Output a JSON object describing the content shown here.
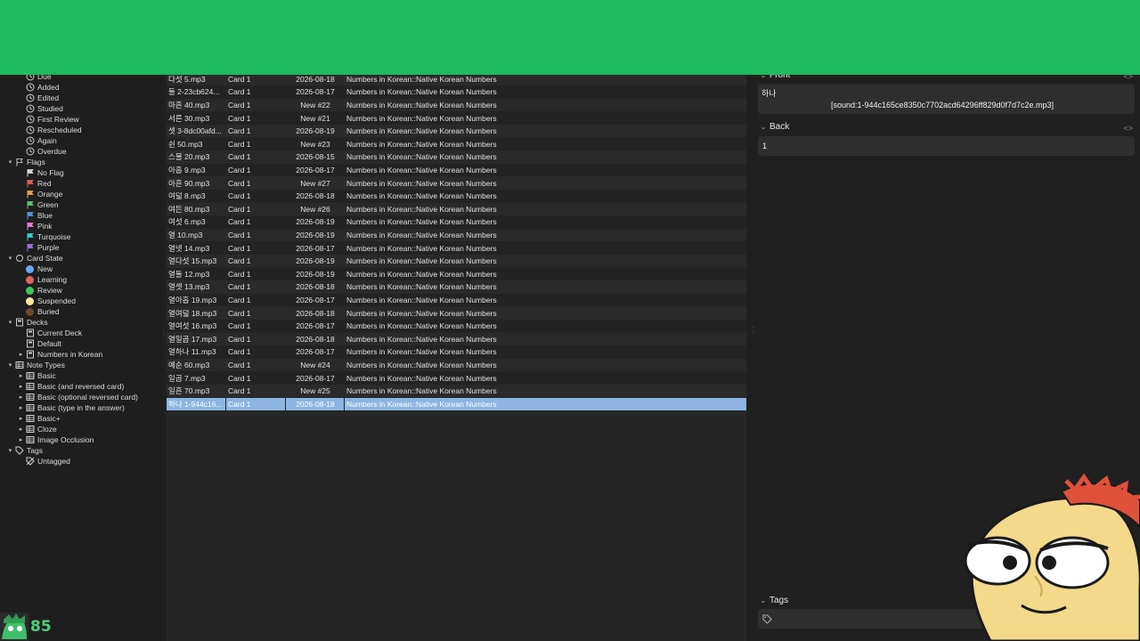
{
  "sidebar": {
    "items": [
      {
        "label": "Due",
        "icon": "clock-icon",
        "indent": 1
      },
      {
        "label": "Added",
        "icon": "clock-icon",
        "indent": 1
      },
      {
        "label": "Edited",
        "icon": "clock-icon",
        "indent": 1
      },
      {
        "label": "Studied",
        "icon": "clock-icon",
        "indent": 1
      },
      {
        "label": "First Review",
        "icon": "clock-icon",
        "indent": 1
      },
      {
        "label": "Rescheduled",
        "icon": "clock-icon",
        "indent": 1
      },
      {
        "label": "Again",
        "icon": "clock-icon",
        "indent": 1
      },
      {
        "label": "Overdue",
        "icon": "clock-icon",
        "indent": 1
      },
      {
        "label": "Flags",
        "icon": "flag-icon",
        "indent": 0,
        "expanded": true
      },
      {
        "label": "No Flag",
        "icon": "flag-icon",
        "indent": 1,
        "color": "#d8d8d8"
      },
      {
        "label": "Red",
        "icon": "flag-icon",
        "indent": 1,
        "color": "#e05c5c"
      },
      {
        "label": "Orange",
        "icon": "flag-icon",
        "indent": 1,
        "color": "#f0a050"
      },
      {
        "label": "Green",
        "icon": "flag-icon",
        "indent": 1,
        "color": "#5cc470"
      },
      {
        "label": "Blue",
        "icon": "flag-icon",
        "indent": 1,
        "color": "#5a8fe0"
      },
      {
        "label": "Pink",
        "icon": "flag-icon",
        "indent": 1,
        "color": "#f07ad0"
      },
      {
        "label": "Turquoise",
        "icon": "flag-icon",
        "indent": 1,
        "color": "#3fc9c9"
      },
      {
        "label": "Purple",
        "icon": "flag-icon",
        "indent": 1,
        "color": "#a070e0"
      },
      {
        "label": "Card State",
        "icon": "card-state-icon",
        "indent": 0,
        "expanded": true
      },
      {
        "label": "New",
        "icon": "dot-icon",
        "indent": 1,
        "color": "#6aa8f0"
      },
      {
        "label": "Learning",
        "icon": "dot-icon",
        "indent": 1,
        "color": "#e06060"
      },
      {
        "label": "Review",
        "icon": "dot-icon",
        "indent": 1,
        "color": "#3cc85a"
      },
      {
        "label": "Suspended",
        "icon": "dot-icon",
        "indent": 1,
        "color": "#f5e6a0"
      },
      {
        "label": "Buried",
        "icon": "dot-icon",
        "indent": 1,
        "color": "#6a4a2a"
      },
      {
        "label": "Decks",
        "icon": "deck-icon",
        "indent": 0,
        "expanded": true
      },
      {
        "label": "Current Deck",
        "icon": "deck-icon",
        "indent": 1
      },
      {
        "label": "Default",
        "icon": "deck-icon",
        "indent": 1
      },
      {
        "label": "Numbers in Korean",
        "icon": "deck-icon",
        "indent": 1,
        "collapsed": true
      },
      {
        "label": "Note Types",
        "icon": "notetype-icon",
        "indent": 0,
        "expanded": true
      },
      {
        "label": "Basic",
        "icon": "notetype-icon",
        "indent": 1,
        "collapsed": true
      },
      {
        "label": "Basic (and reversed card)",
        "icon": "notetype-icon",
        "indent": 1,
        "collapsed": true
      },
      {
        "label": "Basic (optional reversed card)",
        "icon": "notetype-icon",
        "indent": 1,
        "collapsed": true
      },
      {
        "label": "Basic (type in the answer)",
        "icon": "notetype-icon",
        "indent": 1,
        "collapsed": true
      },
      {
        "label": "Basic+",
        "icon": "notetype-icon",
        "indent": 1,
        "collapsed": true
      },
      {
        "label": "Cloze",
        "icon": "notetype-icon",
        "indent": 1,
        "collapsed": true
      },
      {
        "label": "Image Occlusion",
        "icon": "notetype-icon",
        "indent": 1,
        "collapsed": true
      },
      {
        "label": "Tags",
        "icon": "tag-icon",
        "indent": 0,
        "expanded": true
      },
      {
        "label": "Untagged",
        "icon": "tag-off-icon",
        "indent": 1
      }
    ]
  },
  "table": {
    "rows": [
      {
        "sort": "다섯 5.mp3",
        "card": "Card 1",
        "due": "2026-08-18",
        "deck": "Numbers in Korean::Native Korean Numbers"
      },
      {
        "sort": "둘 2-23cb624...",
        "card": "Card 1",
        "due": "2026-08-17",
        "deck": "Numbers in Korean::Native Korean Numbers"
      },
      {
        "sort": "마흔 40.mp3",
        "card": "Card 1",
        "due": "New #22",
        "deck": "Numbers in Korean::Native Korean Numbers"
      },
      {
        "sort": "서른 30.mp3",
        "card": "Card 1",
        "due": "New #21",
        "deck": "Numbers in Korean::Native Korean Numbers"
      },
      {
        "sort": "셋 3-8dc00afd...",
        "card": "Card 1",
        "due": "2026-08-19",
        "deck": "Numbers in Korean::Native Korean Numbers"
      },
      {
        "sort": "쉰 50.mp3",
        "card": "Card 1",
        "due": "New #23",
        "deck": "Numbers in Korean::Native Korean Numbers"
      },
      {
        "sort": "스물 20.mp3",
        "card": "Card 1",
        "due": "2026-08-15",
        "deck": "Numbers in Korean::Native Korean Numbers"
      },
      {
        "sort": "아홉 9.mp3",
        "card": "Card 1",
        "due": "2026-08-17",
        "deck": "Numbers in Korean::Native Korean Numbers"
      },
      {
        "sort": "아흔 90.mp3",
        "card": "Card 1",
        "due": "New #27",
        "deck": "Numbers in Korean::Native Korean Numbers"
      },
      {
        "sort": "여덟 8.mp3",
        "card": "Card 1",
        "due": "2026-08-18",
        "deck": "Numbers in Korean::Native Korean Numbers"
      },
      {
        "sort": "여든 80.mp3",
        "card": "Card 1",
        "due": "New #26",
        "deck": "Numbers in Korean::Native Korean Numbers"
      },
      {
        "sort": "여섯 6.mp3",
        "card": "Card 1",
        "due": "2026-08-19",
        "deck": "Numbers in Korean::Native Korean Numbers"
      },
      {
        "sort": "열 10.mp3",
        "card": "Card 1",
        "due": "2026-08-19",
        "deck": "Numbers in Korean::Native Korean Numbers"
      },
      {
        "sort": "열넷 14.mp3",
        "card": "Card 1",
        "due": "2026-08-17",
        "deck": "Numbers in Korean::Native Korean Numbers"
      },
      {
        "sort": "열다섯 15.mp3",
        "card": "Card 1",
        "due": "2026-08-19",
        "deck": "Numbers in Korean::Native Korean Numbers"
      },
      {
        "sort": "열둘 12.mp3",
        "card": "Card 1",
        "due": "2026-08-19",
        "deck": "Numbers in Korean::Native Korean Numbers"
      },
      {
        "sort": "열셋 13.mp3",
        "card": "Card 1",
        "due": "2026-08-18",
        "deck": "Numbers in Korean::Native Korean Numbers"
      },
      {
        "sort": "열아홉 19.mp3",
        "card": "Card 1",
        "due": "2026-08-17",
        "deck": "Numbers in Korean::Native Korean Numbers"
      },
      {
        "sort": "열여덟 18.mp3",
        "card": "Card 1",
        "due": "2026-08-18",
        "deck": "Numbers in Korean::Native Korean Numbers"
      },
      {
        "sort": "열여섯 16.mp3",
        "card": "Card 1",
        "due": "2026-08-17",
        "deck": "Numbers in Korean::Native Korean Numbers"
      },
      {
        "sort": "열일곱 17.mp3",
        "card": "Card 1",
        "due": "2026-08-18",
        "deck": "Numbers in Korean::Native Korean Numbers"
      },
      {
        "sort": "열하나 11.mp3",
        "card": "Card 1",
        "due": "2026-08-17",
        "deck": "Numbers in Korean::Native Korean Numbers"
      },
      {
        "sort": "예순 60.mp3",
        "card": "Card 1",
        "due": "New #24",
        "deck": "Numbers in Korean::Native Korean Numbers"
      },
      {
        "sort": "일곱 7.mp3",
        "card": "Card 1",
        "due": "2026-08-17",
        "deck": "Numbers in Korean::Native Korean Numbers"
      },
      {
        "sort": "일흔 70.mp3",
        "card": "Card 1",
        "due": "New #25",
        "deck": "Numbers in Korean::Native Korean Numbers"
      },
      {
        "sort": "하나 1-944c16...",
        "card": "Card 1",
        "due": "2026-08-18",
        "deck": "Numbers in Korean::Native Korean Numbers",
        "selected": true
      }
    ]
  },
  "editor": {
    "front_label": "Front",
    "front_line1": "하나",
    "front_line2": "[sound:1-944c165ce8350c7702acd64296ff829d0f7d7c2e.mp3]",
    "back_label": "Back",
    "back_value": "1",
    "tags_label": "Tags",
    "code_toggle": "<>"
  },
  "overlay": {
    "counter": "85",
    "banner_color": "#1cbb5f"
  }
}
